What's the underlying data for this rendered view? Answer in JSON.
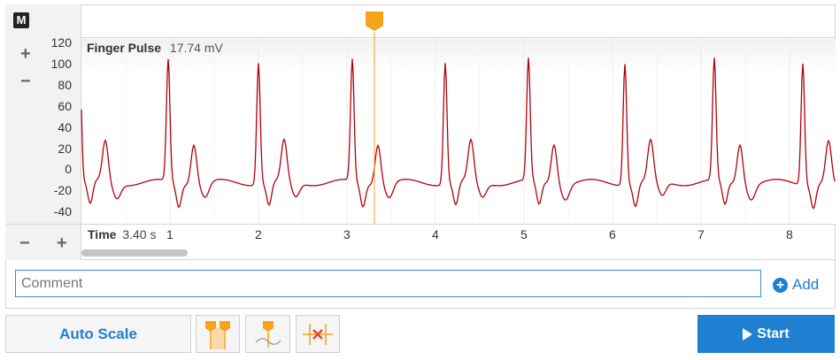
{
  "mode_badge": "M",
  "y_axis": {
    "ticks": [
      "120",
      "100",
      "80",
      "60",
      "40",
      "20",
      "0",
      "-20",
      "-40"
    ],
    "zoom_in": "+",
    "zoom_out": "−"
  },
  "channel": {
    "name": "Finger Pulse",
    "value": "17.74 mV",
    "color": "#b0000f"
  },
  "time": {
    "label": "Time",
    "value": "3.40 s",
    "zoom_out": "−",
    "zoom_in": "+"
  },
  "x_axis": {
    "ticks": [
      "1",
      "2",
      "3",
      "4",
      "5",
      "6",
      "7",
      "8"
    ]
  },
  "marker": {
    "time_s": 3.4,
    "color": "#f7a21b"
  },
  "comment": {
    "placeholder": "Comment",
    "value": ""
  },
  "add_button": {
    "label": "Add"
  },
  "toolbar": {
    "autoscale_label": "Auto Scale",
    "start_label": "Start"
  },
  "colors": {
    "accent": "#1f7fd1",
    "marker": "#f7a21b",
    "trace": "#b0000f",
    "remove": "#e04b2a"
  },
  "icons": [
    "two-markers-icon",
    "single-marker-icon",
    "remove-marker-icon",
    "play-icon",
    "plus-circle-icon"
  ]
}
